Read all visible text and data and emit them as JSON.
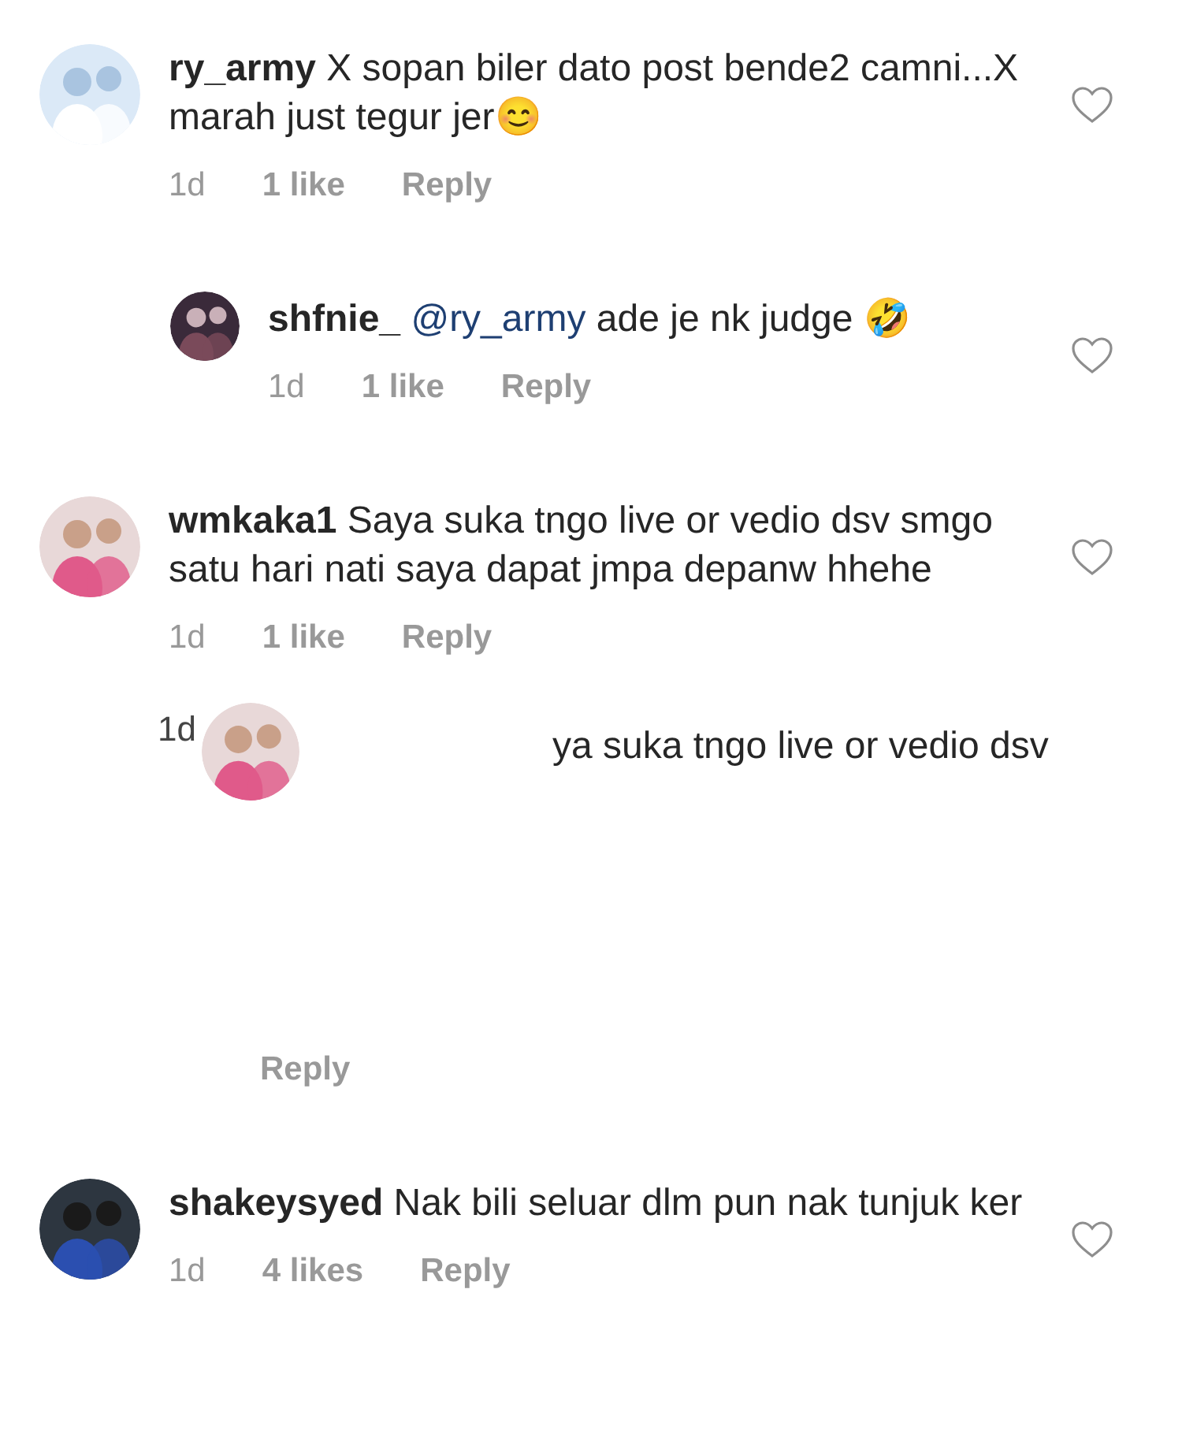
{
  "comments": [
    {
      "kind": "comment",
      "username": "ry_army",
      "text": "X sopan biler dato post bende2 camni...X marah just tegur jer😊",
      "time": "1d",
      "likes": "1 like",
      "reply": "Reply",
      "liked": false
    },
    {
      "kind": "reply",
      "username": "shfnie_",
      "mention": "@ry_army",
      "text": "ade je nk judge 🤣",
      "time": "1d",
      "likes": "1 like",
      "reply": "Reply",
      "liked": false
    },
    {
      "kind": "comment",
      "username": "wmkaka1",
      "text": "Saya suka tngo live or vedio dsv smgo satu hari nati saya dapat jmpa depanw hhehe",
      "time": "1d",
      "likes": "1 like",
      "reply": "Reply",
      "liked": false
    },
    {
      "kind": "glitch",
      "time": "1d",
      "text": "ya suka tngo live or vedio dsv",
      "reply": "Reply"
    },
    {
      "kind": "comment",
      "username": "shakeysyed",
      "text": "Nak bili seluar dlm pun nak tunjuk ker",
      "time": "1d",
      "likes": "4 likes",
      "reply": "Reply",
      "liked": false
    }
  ]
}
